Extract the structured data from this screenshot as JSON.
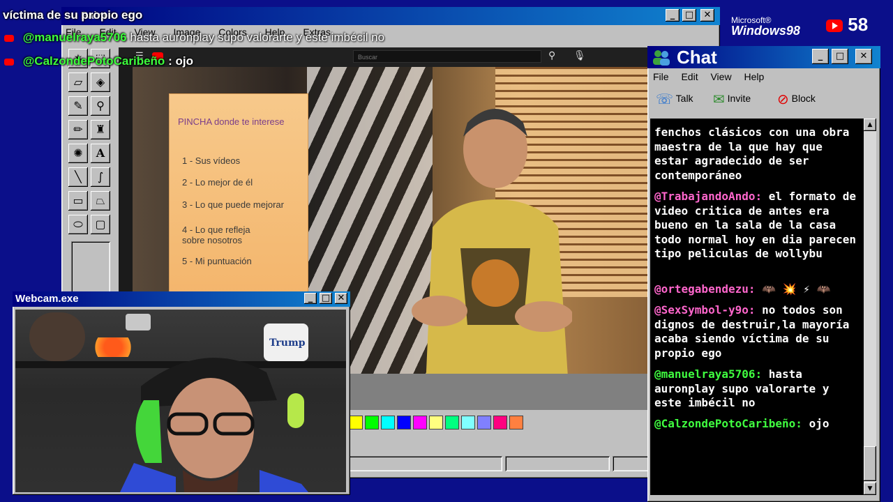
{
  "overlay": {
    "lines": [
      {
        "user": "",
        "text": "víctima de su propio ego"
      },
      {
        "user": "@manuelraya5706",
        "text": "hasta auronplay supo valorarte y este imbécil no"
      },
      {
        "user": "@CalzondePotoCaribeño",
        "text": "ojo"
      }
    ],
    "colors": {
      "user": "#3dff3d",
      "text": "#ffffff",
      "yt_icon": "#ff0000"
    }
  },
  "branding": {
    "microsoft": "Microsoft®",
    "windows": "Windows98",
    "viewer_count": "58"
  },
  "paint": {
    "title": "Paint",
    "menu": [
      "File",
      "Edit",
      "View",
      "Image",
      "Colors",
      "Help",
      "Extras"
    ],
    "palette": [
      "#ffff00",
      "#00ff00",
      "#00ffff",
      "#0000ff",
      "#ff00ff",
      "#ffff80",
      "#00ff80",
      "#80ffff",
      "#8080ff",
      "#ff0080",
      "#ff8040"
    ]
  },
  "video": {
    "search_placeholder": "Buscar",
    "slide": {
      "title": "PINCHA donde te interese",
      "items": [
        "1 - Sus vídeos",
        "2 - Lo mejor de él",
        "3 - Lo que puede mejorar",
        "4 - Lo que refleja\n   sobre nosotros",
        "5 - Mi puntuación"
      ]
    }
  },
  "webcam": {
    "title": "Webcam.exe",
    "cup_text": "Trump"
  },
  "chat": {
    "title": "Chat",
    "menu": [
      "File",
      "Edit",
      "View",
      "Help"
    ],
    "toolbar": [
      "Talk",
      "Invite",
      "Block"
    ],
    "messages": [
      {
        "user": "",
        "text": "fenchos clásicos con una obra maestra de la que hay que estar agradecido de ser contemporáneo"
      },
      {
        "user": "@TrabajandoAndo:",
        "text": "el formato de video critica de antes era bueno en la sala de la casa todo normal hoy en dia parecen tipo peliculas de wollybu"
      },
      {
        "user": "@ortegabendezu:",
        "text": "🦇 💥 ⚡ 🦇"
      },
      {
        "user": "@SexSymbol-y9o:",
        "text": "no todos son dignos de destruir,la mayoría acaba siendo víctima de su propio ego"
      },
      {
        "user": "@manuelraya5706:",
        "text": "hasta auronplay supo valorarte y este imbécil no"
      },
      {
        "user": "@CalzondePotoCaribeño:",
        "text": "ojo"
      }
    ],
    "colors": {
      "user_green": "#40ff40",
      "user_pink": "#ff66cc",
      "background": "#000000"
    }
  }
}
